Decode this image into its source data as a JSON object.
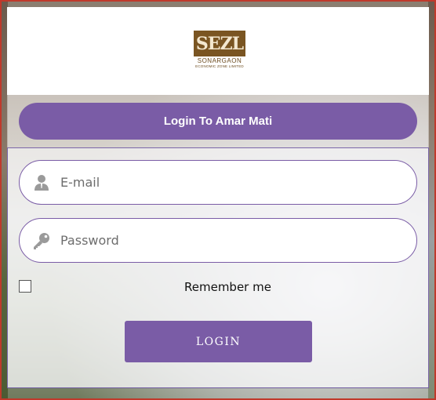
{
  "logo": {
    "mark": "SEZL",
    "name": "SONARGAON",
    "subtitle": "ECONOMIC ZONE LIMITED"
  },
  "login_form": {
    "tab_label": "Login To Amar Mati",
    "email_placeholder": "E-mail",
    "email_value": "",
    "password_placeholder": "Password",
    "password_value": "",
    "remember_label": "Remember me",
    "remember_checked": false,
    "submit_label": "LOGIN"
  },
  "icons": {
    "email": "user-icon",
    "password": "key-icon"
  },
  "colors": {
    "accent": "#7a5ca6",
    "logo_brown": "#7a5522"
  }
}
